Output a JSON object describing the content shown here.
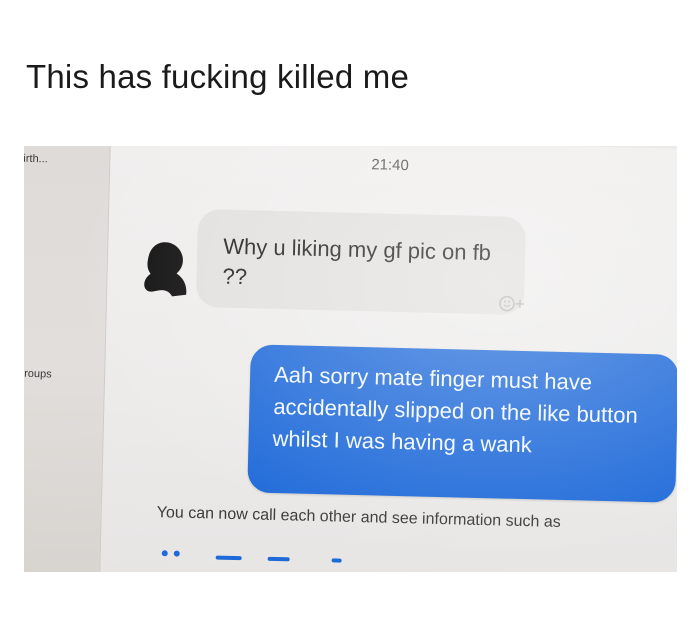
{
  "caption": "This has fucking killed me",
  "screen": {
    "left_panel": {
      "top_item": "irth...",
      "groups_item": "groups"
    },
    "timestamp": "21:40",
    "incoming_message": "Why u liking my gf pic on fb ??",
    "outgoing_message": "Aah sorry mate finger must have accidentally slipped on the like button whilst I was having a wank",
    "footer_notice": "You can now call each other and see information such as",
    "icons": {
      "avatar": "avatar-silhouette-icon",
      "reaction": "add-reaction-icon",
      "seen": "seen-indicator-icon"
    },
    "colors": {
      "outgoing_bubble": "#1f6ad9",
      "incoming_bubble": "#e2e0de"
    }
  }
}
